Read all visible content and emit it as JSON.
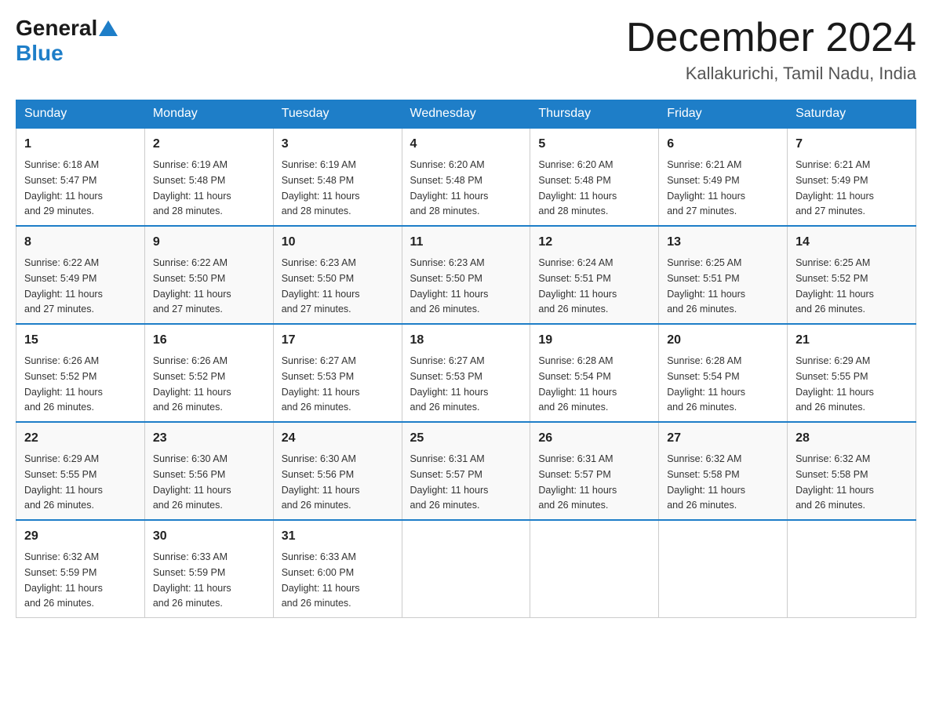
{
  "header": {
    "logo_general": "General",
    "logo_blue": "Blue",
    "month_title": "December 2024",
    "location": "Kallakurichi, Tamil Nadu, India"
  },
  "days_of_week": [
    "Sunday",
    "Monday",
    "Tuesday",
    "Wednesday",
    "Thursday",
    "Friday",
    "Saturday"
  ],
  "weeks": [
    [
      {
        "day": "1",
        "sunrise": "6:18 AM",
        "sunset": "5:47 PM",
        "daylight": "11 hours and 29 minutes."
      },
      {
        "day": "2",
        "sunrise": "6:19 AM",
        "sunset": "5:48 PM",
        "daylight": "11 hours and 28 minutes."
      },
      {
        "day": "3",
        "sunrise": "6:19 AM",
        "sunset": "5:48 PM",
        "daylight": "11 hours and 28 minutes."
      },
      {
        "day": "4",
        "sunrise": "6:20 AM",
        "sunset": "5:48 PM",
        "daylight": "11 hours and 28 minutes."
      },
      {
        "day": "5",
        "sunrise": "6:20 AM",
        "sunset": "5:48 PM",
        "daylight": "11 hours and 28 minutes."
      },
      {
        "day": "6",
        "sunrise": "6:21 AM",
        "sunset": "5:49 PM",
        "daylight": "11 hours and 27 minutes."
      },
      {
        "day": "7",
        "sunrise": "6:21 AM",
        "sunset": "5:49 PM",
        "daylight": "11 hours and 27 minutes."
      }
    ],
    [
      {
        "day": "8",
        "sunrise": "6:22 AM",
        "sunset": "5:49 PM",
        "daylight": "11 hours and 27 minutes."
      },
      {
        "day": "9",
        "sunrise": "6:22 AM",
        "sunset": "5:50 PM",
        "daylight": "11 hours and 27 minutes."
      },
      {
        "day": "10",
        "sunrise": "6:23 AM",
        "sunset": "5:50 PM",
        "daylight": "11 hours and 27 minutes."
      },
      {
        "day": "11",
        "sunrise": "6:23 AM",
        "sunset": "5:50 PM",
        "daylight": "11 hours and 26 minutes."
      },
      {
        "day": "12",
        "sunrise": "6:24 AM",
        "sunset": "5:51 PM",
        "daylight": "11 hours and 26 minutes."
      },
      {
        "day": "13",
        "sunrise": "6:25 AM",
        "sunset": "5:51 PM",
        "daylight": "11 hours and 26 minutes."
      },
      {
        "day": "14",
        "sunrise": "6:25 AM",
        "sunset": "5:52 PM",
        "daylight": "11 hours and 26 minutes."
      }
    ],
    [
      {
        "day": "15",
        "sunrise": "6:26 AM",
        "sunset": "5:52 PM",
        "daylight": "11 hours and 26 minutes."
      },
      {
        "day": "16",
        "sunrise": "6:26 AM",
        "sunset": "5:52 PM",
        "daylight": "11 hours and 26 minutes."
      },
      {
        "day": "17",
        "sunrise": "6:27 AM",
        "sunset": "5:53 PM",
        "daylight": "11 hours and 26 minutes."
      },
      {
        "day": "18",
        "sunrise": "6:27 AM",
        "sunset": "5:53 PM",
        "daylight": "11 hours and 26 minutes."
      },
      {
        "day": "19",
        "sunrise": "6:28 AM",
        "sunset": "5:54 PM",
        "daylight": "11 hours and 26 minutes."
      },
      {
        "day": "20",
        "sunrise": "6:28 AM",
        "sunset": "5:54 PM",
        "daylight": "11 hours and 26 minutes."
      },
      {
        "day": "21",
        "sunrise": "6:29 AM",
        "sunset": "5:55 PM",
        "daylight": "11 hours and 26 minutes."
      }
    ],
    [
      {
        "day": "22",
        "sunrise": "6:29 AM",
        "sunset": "5:55 PM",
        "daylight": "11 hours and 26 minutes."
      },
      {
        "day": "23",
        "sunrise": "6:30 AM",
        "sunset": "5:56 PM",
        "daylight": "11 hours and 26 minutes."
      },
      {
        "day": "24",
        "sunrise": "6:30 AM",
        "sunset": "5:56 PM",
        "daylight": "11 hours and 26 minutes."
      },
      {
        "day": "25",
        "sunrise": "6:31 AM",
        "sunset": "5:57 PM",
        "daylight": "11 hours and 26 minutes."
      },
      {
        "day": "26",
        "sunrise": "6:31 AM",
        "sunset": "5:57 PM",
        "daylight": "11 hours and 26 minutes."
      },
      {
        "day": "27",
        "sunrise": "6:32 AM",
        "sunset": "5:58 PM",
        "daylight": "11 hours and 26 minutes."
      },
      {
        "day": "28",
        "sunrise": "6:32 AM",
        "sunset": "5:58 PM",
        "daylight": "11 hours and 26 minutes."
      }
    ],
    [
      {
        "day": "29",
        "sunrise": "6:32 AM",
        "sunset": "5:59 PM",
        "daylight": "11 hours and 26 minutes."
      },
      {
        "day": "30",
        "sunrise": "6:33 AM",
        "sunset": "5:59 PM",
        "daylight": "11 hours and 26 minutes."
      },
      {
        "day": "31",
        "sunrise": "6:33 AM",
        "sunset": "6:00 PM",
        "daylight": "11 hours and 26 minutes."
      },
      null,
      null,
      null,
      null
    ]
  ],
  "cell_labels": {
    "sunrise": "Sunrise:",
    "sunset": "Sunset:",
    "daylight": "Daylight:"
  }
}
